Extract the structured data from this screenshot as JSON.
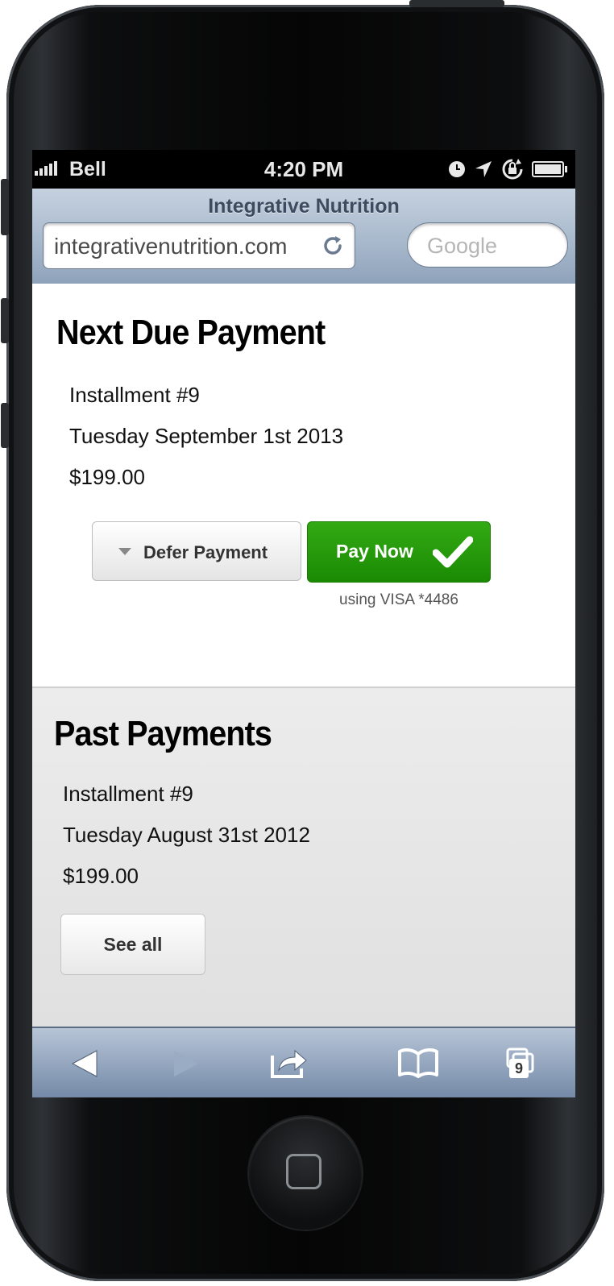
{
  "status_bar": {
    "carrier": "Bell",
    "time": "4:20 PM"
  },
  "browser": {
    "page_title": "Integrative Nutrition",
    "url": "integrativenutrition.com",
    "search_placeholder": "Google",
    "tabs_count": "9"
  },
  "next_due": {
    "heading": "Next Due Payment",
    "installment": "Installment #9",
    "date": "Tuesday September 1st  2013",
    "amount": "$199.00",
    "defer_label": "Defer Payment",
    "pay_label": "Pay Now",
    "payment_method": "using VISA *4486"
  },
  "past": {
    "heading": "Past Payments",
    "installment": "Installment #9",
    "date": "Tuesday August 31st  2012",
    "amount": "$199.00",
    "see_all_label": "See all"
  },
  "colors": {
    "pay_button": "#229a0a",
    "toolbar": "#8ea1ba",
    "title_text": "#3d4b60"
  },
  "icons": [
    "signal-icon",
    "clock-icon",
    "location-arrow-icon",
    "rotation-lock-icon",
    "battery-icon",
    "reload-icon",
    "checkmark-icon",
    "back-arrow-icon",
    "forward-arrow-icon",
    "share-icon",
    "bookmarks-icon",
    "tabs-icon"
  ]
}
